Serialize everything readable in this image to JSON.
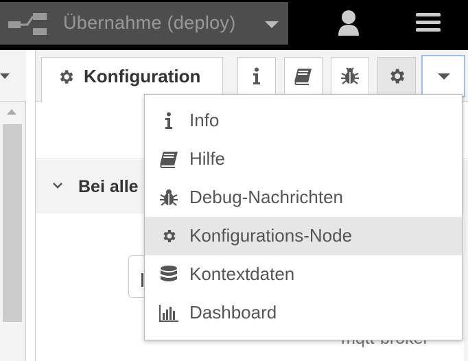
{
  "header": {
    "deploy_label": "Übernahme (deploy)",
    "icons": [
      "deploy-icon",
      "user-icon",
      "hamburger-menu-icon"
    ],
    "background": "#000000"
  },
  "sidebar": {
    "active_tab_label": "Konfiguration",
    "toolbar_buttons": [
      "info-icon",
      "book-icon",
      "bug-icon",
      "gear-icon"
    ],
    "selected_toolbar_button": "gear-icon",
    "section_title": "Bei alle",
    "node_reference": "mqtt-broker"
  },
  "menu": {
    "items": [
      {
        "label": "Info",
        "icon": "info-icon"
      },
      {
        "label": "Hilfe",
        "icon": "book-icon"
      },
      {
        "label": "Debug-Nachrichten",
        "icon": "bug-icon"
      },
      {
        "label": "Konfigurations-Node",
        "icon": "gear-icon",
        "highlighted": true
      },
      {
        "label": "Kontextdaten",
        "icon": "database-icon"
      },
      {
        "label": "Dashboard",
        "icon": "bar-chart-icon"
      }
    ]
  },
  "colors": {
    "accent_border": "#9ec1e3",
    "highlight_bg": "#e6e6e6",
    "panel_bg": "#f3f3f3"
  }
}
